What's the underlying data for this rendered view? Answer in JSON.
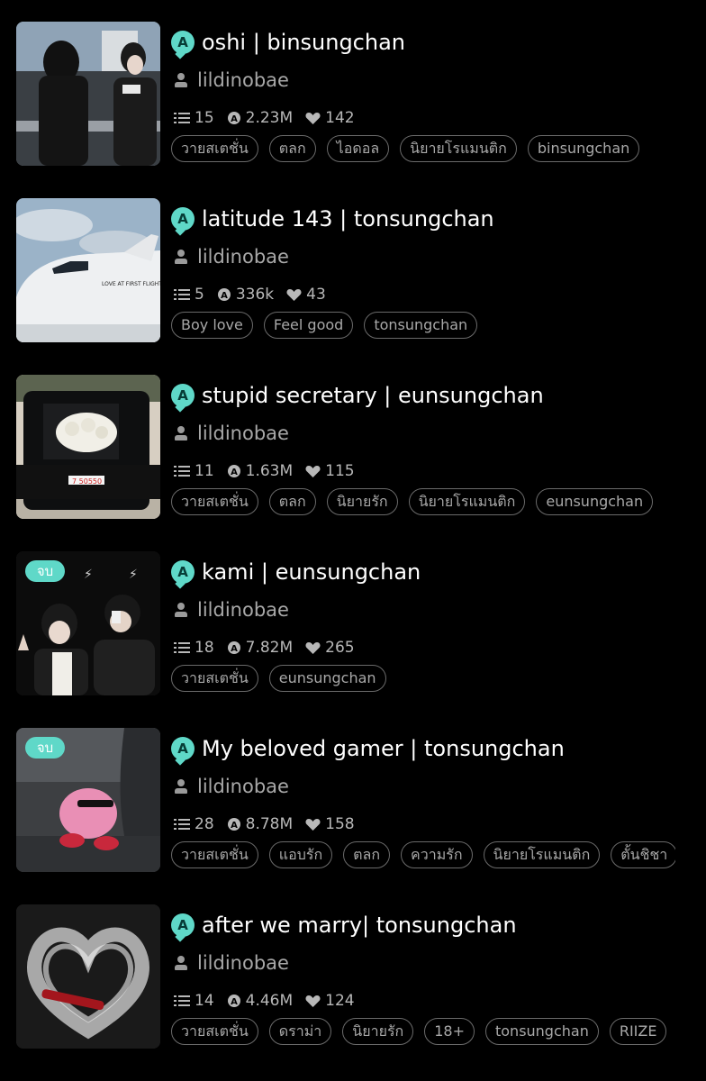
{
  "colors": {
    "accent": "#5fd8c8",
    "background": "#000000",
    "muted_text": "#a8a8a8"
  },
  "icons": {
    "list": "list-icon",
    "views": "reads-icon",
    "votes": "heart-icon",
    "author": "person-icon",
    "badge": "a-badge-icon"
  },
  "stories": [
    {
      "title": "oshi | binsungchan",
      "author": "lildinobae",
      "parts": "15",
      "views": "2.23M",
      "votes": "142",
      "complete_badge": "",
      "tags": [
        "วายสเตชั่น",
        "ตลก",
        "ไอดอล",
        "นิยายโรแมนติก",
        "binsungchan"
      ]
    },
    {
      "title": "latitude 143 | tonsungchan",
      "author": "lildinobae",
      "parts": "5",
      "views": "336k",
      "votes": "43",
      "complete_badge": "",
      "tags": [
        "Boy love",
        "Feel good",
        "tonsungchan"
      ]
    },
    {
      "title": "stupid secretary | eunsungchan",
      "author": "lildinobae",
      "parts": "11",
      "views": "1.63M",
      "votes": "115",
      "complete_badge": "",
      "tags": [
        "วายสเตชั่น",
        "ตลก",
        "นิยายรัก",
        "นิยายโรแมนติก",
        "eunsungchan"
      ]
    },
    {
      "title": "kami | eunsungchan",
      "author": "lildinobae",
      "parts": "18",
      "views": "7.82M",
      "votes": "265",
      "complete_badge": "จบ",
      "tags": [
        "วายสเตชั่น",
        "eunsungchan"
      ]
    },
    {
      "title": "My beloved gamer | tonsungchan",
      "author": "lildinobae",
      "parts": "28",
      "views": "8.78M",
      "votes": "158",
      "complete_badge": "จบ",
      "tags": [
        "วายสเตชั่น",
        "แอบรัก",
        "ตลก",
        "ความรัก",
        "นิยายโรแมนติก",
        "ตั้นชิชา"
      ]
    },
    {
      "title": "after we marry| tonsungchan",
      "author": "lildinobae",
      "parts": "14",
      "views": "4.46M",
      "votes": "124",
      "complete_badge": "",
      "tags": [
        "วายสเตชั่น",
        "ดราม่า",
        "นิยายรัก",
        "18+",
        "tonsungchan",
        "RIIZE"
      ]
    }
  ]
}
